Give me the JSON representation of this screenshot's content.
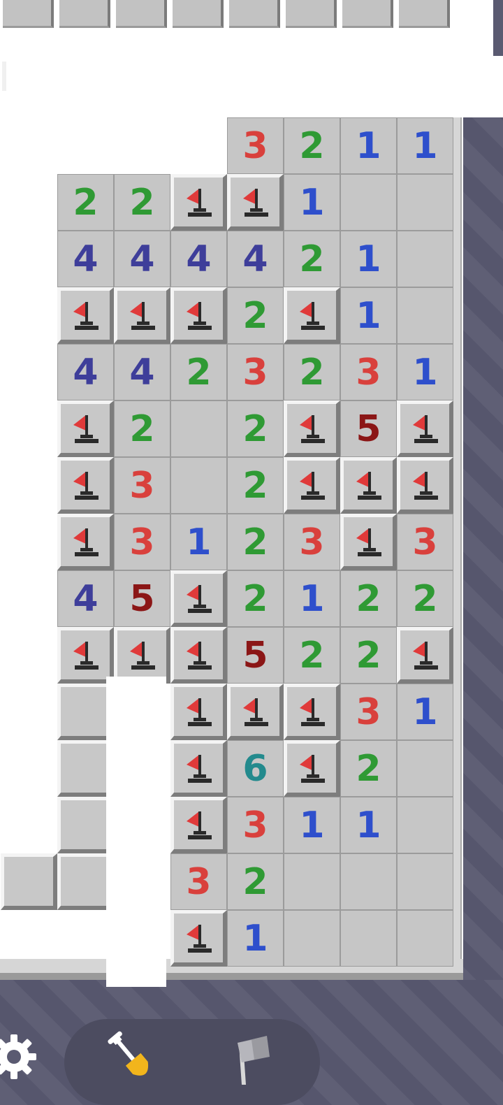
{
  "colors": {
    "n1": "#2e4fcc",
    "n2": "#2f9a34",
    "n3": "#d9403c",
    "n4": "#3e3e9a",
    "n5": "#8b1616",
    "n6": "#238a8d",
    "flag": "#e03a3a",
    "flag_base": "#2a2a2a",
    "background": "#5a5a71",
    "shovel": "#f2b51c"
  },
  "board": {
    "rows": [
      [
        "",
        "",
        "",
        "",
        "3",
        "2",
        "1",
        "1"
      ],
      [
        "",
        "2",
        "2",
        "F",
        "F",
        "1",
        "0",
        "0"
      ],
      [
        "",
        "4",
        "4",
        "4",
        "4",
        "2",
        "1",
        "0"
      ],
      [
        "",
        "F",
        "F",
        "F",
        "2",
        "F",
        "1",
        "0"
      ],
      [
        "",
        "4",
        "4",
        "2",
        "3",
        "2",
        "3",
        "1"
      ],
      [
        "",
        "F",
        "2",
        "0",
        "2",
        "F",
        "5",
        "F"
      ],
      [
        "",
        "F",
        "3",
        "0",
        "2",
        "F",
        "F",
        "F"
      ],
      [
        "",
        "F",
        "3",
        "1",
        "2",
        "3",
        "F",
        "3"
      ],
      [
        "",
        "4",
        "5",
        "F",
        "2",
        "1",
        "2",
        "2"
      ],
      [
        "",
        "F",
        "F",
        "F",
        "5",
        "2",
        "2",
        "F"
      ],
      [
        "",
        "C",
        "",
        "F",
        "F",
        "F",
        "3",
        "1"
      ],
      [
        "",
        "C",
        "",
        "F",
        "6",
        "F",
        "2",
        "0"
      ],
      [
        "",
        "C",
        "",
        "F",
        "3",
        "1",
        "1",
        "0"
      ],
      [
        "C",
        "C",
        "",
        "3",
        "2",
        "0",
        "0",
        "0"
      ],
      [
        "",
        "",
        "",
        "F",
        "1",
        "0",
        "0",
        "0"
      ]
    ]
  },
  "toolbar": {
    "settings_icon": "gear-icon",
    "dig_icon": "shovel-icon",
    "flag_icon": "flag-icon"
  }
}
